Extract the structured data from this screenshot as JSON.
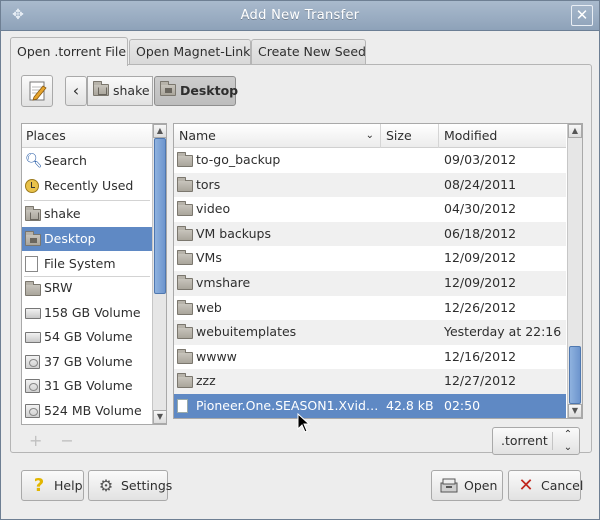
{
  "window": {
    "title": "Add New Transfer",
    "close_glyph": "✕",
    "menu_glyph": "✥"
  },
  "tabs": [
    {
      "label": "Open .torrent File",
      "active": true
    },
    {
      "label": "Open Magnet-Link",
      "active": false
    },
    {
      "label": "Create New Seed",
      "active": false
    }
  ],
  "pathbar": {
    "edit_icon": "pencil-edit-icon",
    "back_glyph": "‹",
    "crumbs": [
      {
        "label": "shake",
        "icon": "home-folder-icon"
      },
      {
        "label": "Desktop",
        "icon": "desktop-folder-icon",
        "active": true
      }
    ]
  },
  "places": {
    "header": "Places",
    "items": [
      {
        "label": "Search",
        "icon": "search-icon"
      },
      {
        "label": "Recently Used",
        "icon": "recent-clock-icon"
      },
      {
        "label": "shake",
        "icon": "home-folder-icon"
      },
      {
        "label": "Desktop",
        "icon": "desktop-folder-icon",
        "selected": true
      },
      {
        "label": "File System",
        "icon": "filesystem-icon"
      },
      {
        "label": "SRW",
        "icon": "drive-icon"
      },
      {
        "label": "158 GB Volume",
        "icon": "drive-icon"
      },
      {
        "label": "54 GB Volume",
        "icon": "drive-icon"
      },
      {
        "label": "37 GB Volume",
        "icon": "external-drive-icon"
      },
      {
        "label": "31 GB Volume",
        "icon": "external-drive-icon"
      },
      {
        "label": "524 MB Volume",
        "icon": "external-drive-icon"
      }
    ],
    "add_glyph": "+",
    "remove_glyph": "−"
  },
  "files": {
    "columns": {
      "name": "Name",
      "size": "Size",
      "modified": "Modified"
    },
    "sort_glyph": "⌄",
    "rows": [
      {
        "name": "to-go_backup",
        "size": "",
        "modified": "09/03/2012",
        "type": "folder"
      },
      {
        "name": "tors",
        "size": "",
        "modified": "08/24/2011",
        "type": "folder"
      },
      {
        "name": "video",
        "size": "",
        "modified": "04/30/2012",
        "type": "folder"
      },
      {
        "name": "VM backups",
        "size": "",
        "modified": "06/18/2012",
        "type": "folder"
      },
      {
        "name": "VMs",
        "size": "",
        "modified": "12/09/2012",
        "type": "folder"
      },
      {
        "name": "vmshare",
        "size": "",
        "modified": "12/09/2012",
        "type": "folder"
      },
      {
        "name": "web",
        "size": "",
        "modified": "12/26/2012",
        "type": "folder"
      },
      {
        "name": "webuitemplates",
        "size": "",
        "modified": "Yesterday at 22:16",
        "type": "folder"
      },
      {
        "name": "wwww",
        "size": "",
        "modified": "12/16/2012",
        "type": "folder"
      },
      {
        "name": "zzz",
        "size": "",
        "modified": "12/27/2012",
        "type": "folder"
      },
      {
        "name": "Pioneer.One.SEASON1.Xvid-...",
        "size": "42.8 kB",
        "modified": "02:50",
        "type": "file",
        "selected": true
      }
    ]
  },
  "filter": {
    "value": ".torrent",
    "glyph": "⌃⌄"
  },
  "buttons": {
    "help": {
      "label": "Help",
      "icon": "help-question-icon",
      "glyph": "?"
    },
    "settings": {
      "label": "Settings",
      "icon": "settings-gear-icon",
      "glyph": "⚙"
    },
    "open": {
      "label": "Open",
      "icon": "open-drawer-icon",
      "glyph": "▭"
    },
    "cancel": {
      "label": "Cancel",
      "icon": "cancel-x-icon",
      "glyph": "✕"
    }
  },
  "colors": {
    "selection": "#5f89c4",
    "titlebar": "#95a8bf",
    "cancel_red": "#c0251c",
    "help_yellow": "#e2b600"
  }
}
